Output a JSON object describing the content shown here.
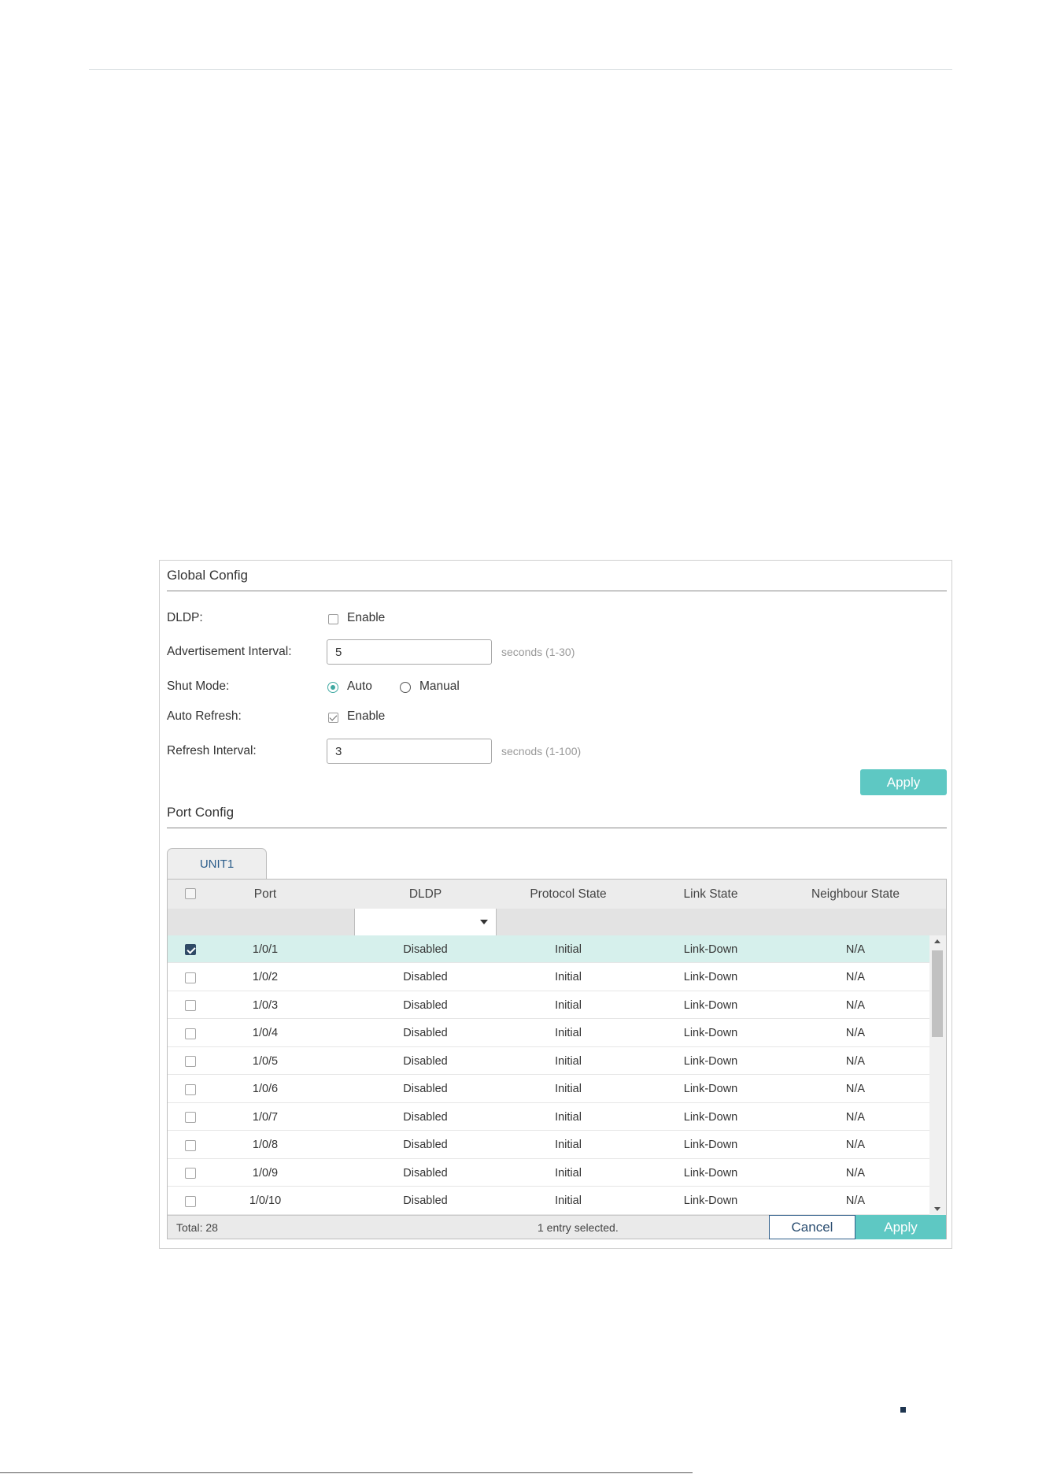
{
  "global_config": {
    "title": "Global Config",
    "dldp": {
      "label": "DLDP:",
      "option": "Enable",
      "checked": false
    },
    "advertisement_interval": {
      "label": "Advertisement Interval:",
      "value": "5",
      "hint": "seconds (1-30)"
    },
    "shut_mode": {
      "label": "Shut Mode:",
      "options": [
        "Auto",
        "Manual"
      ],
      "selected": "Auto"
    },
    "auto_refresh": {
      "label": "Auto Refresh:",
      "option": "Enable",
      "checked": true
    },
    "refresh_interval": {
      "label": "Refresh Interval:",
      "value": "3",
      "hint": "secnods (1-100)"
    },
    "apply_label": "Apply"
  },
  "port_config": {
    "title": "Port Config",
    "tab": "UNIT1",
    "columns": [
      "Port",
      "DLDP",
      "Protocol State",
      "Link State",
      "Neighbour State"
    ],
    "filter_value": "",
    "rows": [
      {
        "port": "1/0/1",
        "dldp": "Disabled",
        "protocol_state": "Initial",
        "link_state": "Link-Down",
        "neighbour_state": "N/A",
        "selected": true
      },
      {
        "port": "1/0/2",
        "dldp": "Disabled",
        "protocol_state": "Initial",
        "link_state": "Link-Down",
        "neighbour_state": "N/A",
        "selected": false
      },
      {
        "port": "1/0/3",
        "dldp": "Disabled",
        "protocol_state": "Initial",
        "link_state": "Link-Down",
        "neighbour_state": "N/A",
        "selected": false
      },
      {
        "port": "1/0/4",
        "dldp": "Disabled",
        "protocol_state": "Initial",
        "link_state": "Link-Down",
        "neighbour_state": "N/A",
        "selected": false
      },
      {
        "port": "1/0/5",
        "dldp": "Disabled",
        "protocol_state": "Initial",
        "link_state": "Link-Down",
        "neighbour_state": "N/A",
        "selected": false
      },
      {
        "port": "1/0/6",
        "dldp": "Disabled",
        "protocol_state": "Initial",
        "link_state": "Link-Down",
        "neighbour_state": "N/A",
        "selected": false
      },
      {
        "port": "1/0/7",
        "dldp": "Disabled",
        "protocol_state": "Initial",
        "link_state": "Link-Down",
        "neighbour_state": "N/A",
        "selected": false
      },
      {
        "port": "1/0/8",
        "dldp": "Disabled",
        "protocol_state": "Initial",
        "link_state": "Link-Down",
        "neighbour_state": "N/A",
        "selected": false
      },
      {
        "port": "1/0/9",
        "dldp": "Disabled",
        "protocol_state": "Initial",
        "link_state": "Link-Down",
        "neighbour_state": "N/A",
        "selected": false
      },
      {
        "port": "1/0/10",
        "dldp": "Disabled",
        "protocol_state": "Initial",
        "link_state": "Link-Down",
        "neighbour_state": "N/A",
        "selected": false
      }
    ],
    "footer": {
      "total": "Total: 28",
      "selection": "1 entry selected.",
      "cancel_label": "Cancel",
      "apply_label": "Apply"
    }
  },
  "colors": {
    "accent": "#5ec8c3",
    "selected_row": "#d6f0ec",
    "checkbox_checked": "#2f4a66",
    "cancel_border": "#2f5e8a"
  }
}
